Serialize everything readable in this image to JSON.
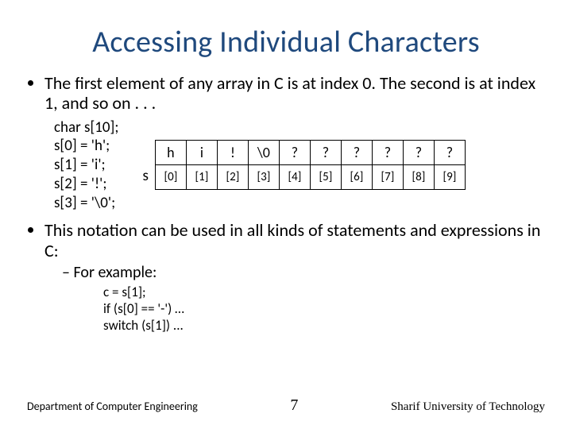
{
  "title": "Accessing Individual Characters",
  "bullet1": "The first element of any array in C is at index 0.  The second is at index 1, and so on . . .",
  "code_lines": {
    "l0": "char s[10];",
    "l1": "s[0] = 'h';",
    "l2": "s[1] = 'i';",
    "l3": "s[2] = '!';",
    "l4": "s[3] = '\\0';"
  },
  "array_label": "s",
  "array_values": {
    "v0": "h",
    "v1": "i",
    "v2": "!",
    "v3": "\\0",
    "v4": "?",
    "v5": "?",
    "v6": "?",
    "v7": "?",
    "v8": "?",
    "v9": "?"
  },
  "array_indices": {
    "i0": "[0]",
    "i1": "[1]",
    "i2": "[2]",
    "i3": "[3]",
    "i4": "[4]",
    "i5": "[5]",
    "i6": "[6]",
    "i7": "[7]",
    "i8": "[8]",
    "i9": "[9]"
  },
  "bullet2": "This notation can be used in all kinds of statements and expressions in C:",
  "sub_bullet": "For example:",
  "example_lines": {
    "e0": "c = s[1];",
    "e1": "if (s[0] == '-') …",
    "e2": "switch (s[1]) ..."
  },
  "footer": {
    "dept": "Department of Computer Engineering",
    "page": "7",
    "uni": "Sharif University of Technology"
  }
}
